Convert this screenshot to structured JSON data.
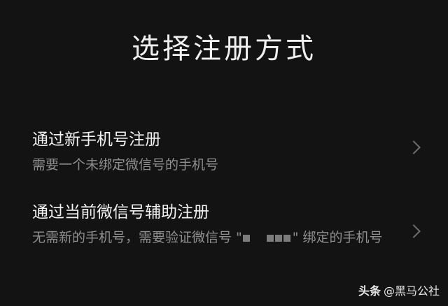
{
  "page": {
    "title": "选择注册方式"
  },
  "options": [
    {
      "title": "通过新手机号注册",
      "description": "需要一个未绑定微信号的手机号"
    },
    {
      "title": "通过当前微信号辅助注册",
      "description_prefix": "无需新的手机号，需要验证微信号 \"",
      "description_suffix": "\" 绑定的手机号"
    }
  ],
  "icons": {
    "chevron": "chevron-right-icon"
  },
  "watermark": {
    "brand": "头条",
    "handle": "@黑马公社"
  },
  "colors": {
    "background": "#131313",
    "primary_text": "#f2f2f2",
    "secondary_text": "#8f8f8f",
    "chevron": "#6f6f6f"
  }
}
